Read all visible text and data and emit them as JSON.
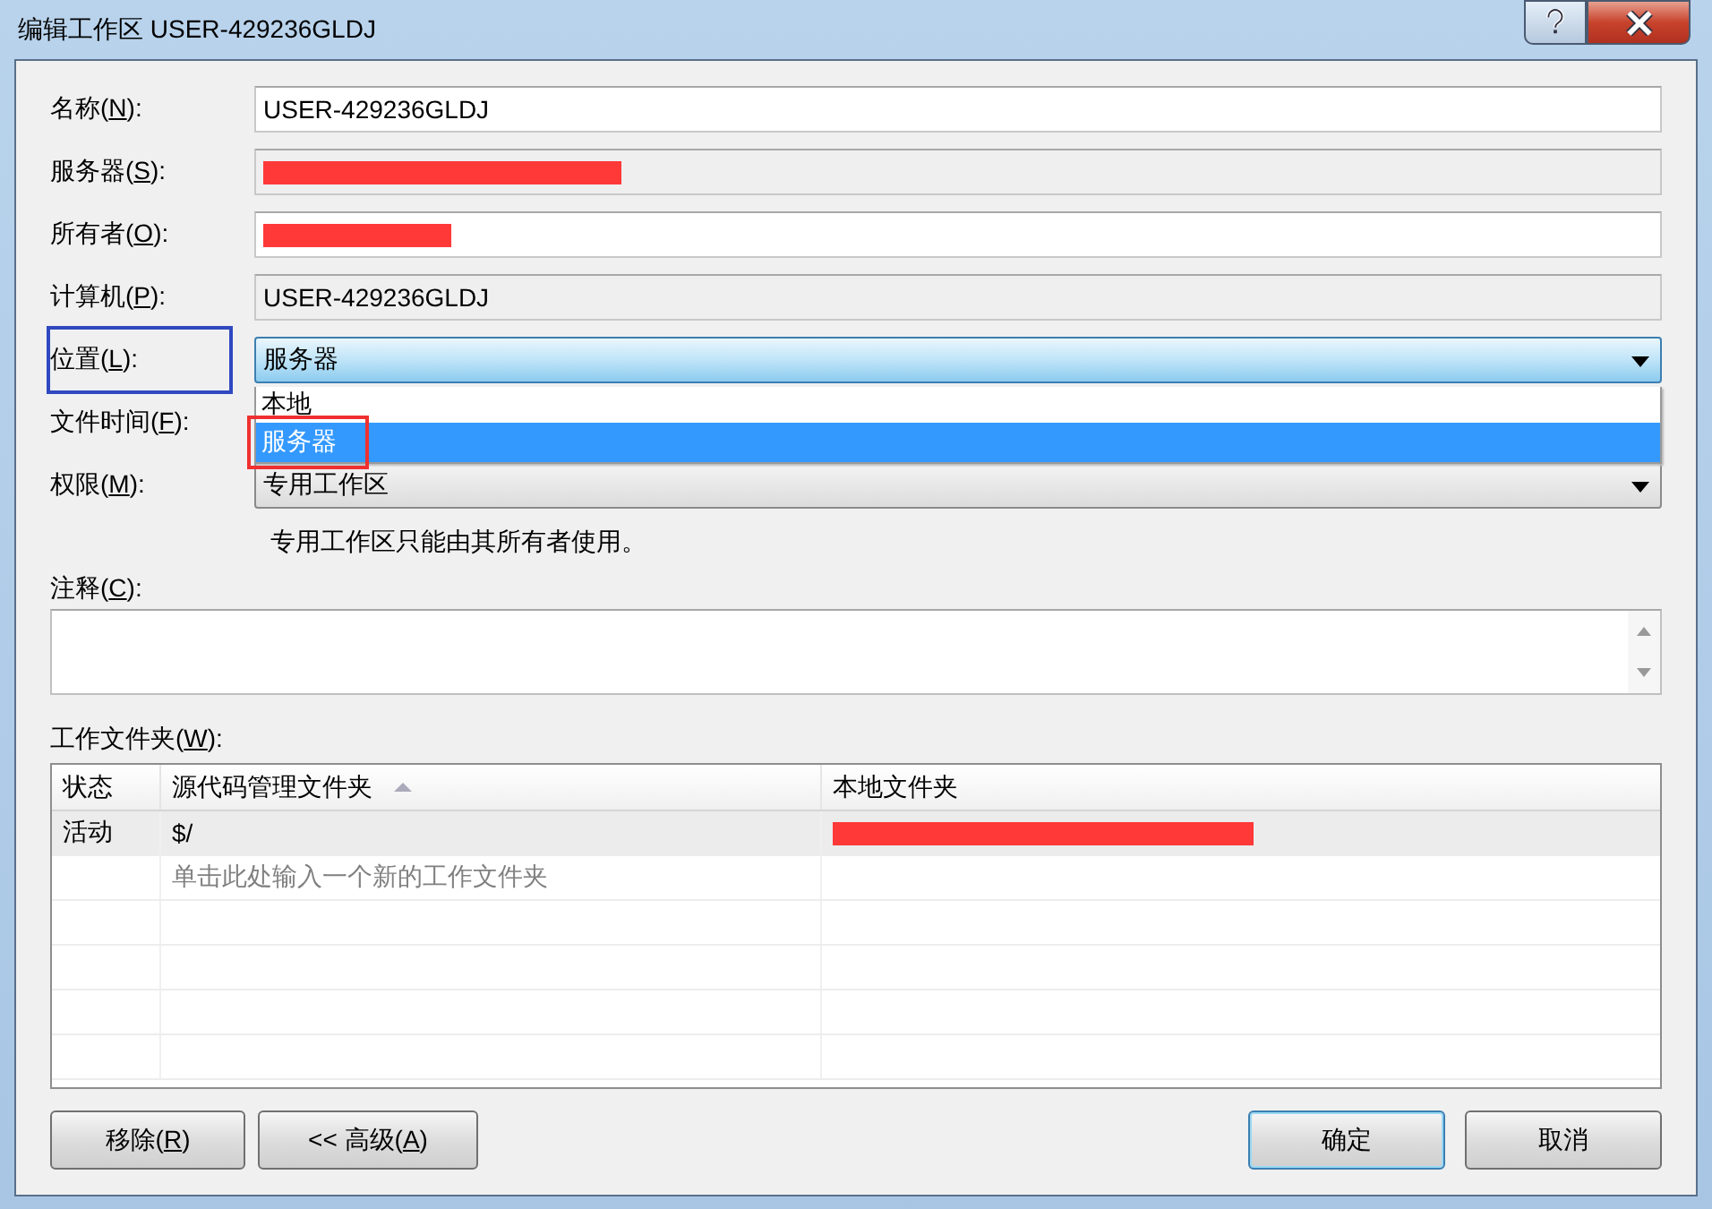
{
  "window": {
    "title": "编辑工作区 USER-429236GLDJ",
    "buttons": [
      {
        "kind": "help"
      },
      {
        "kind": "close"
      }
    ]
  },
  "fields": [
    {
      "label": [
        "名称(",
        "N",
        "):"
      ],
      "kind": "text",
      "value": "USER-429236GLDJ",
      "redacted": false
    },
    {
      "label": [
        "服务器(",
        "S",
        "):"
      ],
      "kind": "readonly",
      "redacted": true
    },
    {
      "label": [
        "所有者(",
        "O",
        "):"
      ],
      "kind": "text",
      "redacted": true
    },
    {
      "label": [
        "计算机(",
        "P",
        "):"
      ],
      "kind": "readonly",
      "value": "USER-429236GLDJ",
      "redacted": false
    },
    {
      "label": [
        "位置(",
        "L",
        "):"
      ],
      "kind": "combo",
      "value": "服务器",
      "redacted": false,
      "focused": true,
      "color": "#3048c0",
      "dropdown": [
        {
          "label": "本地",
          "selected": false
        },
        {
          "label": "服务器",
          "selected": true,
          "color": "#f03030"
        }
      ]
    },
    {
      "label": [
        "文件时间(",
        "F",
        "):"
      ],
      "kind": "hidden"
    },
    {
      "label": [
        "权限(",
        "M",
        "):"
      ],
      "kind": "combo",
      "value": "专用工作区",
      "redacted": false,
      "focused": false
    }
  ],
  "permission_note": "专用工作区只能由其所有者使用。",
  "comment": {
    "label": [
      "注释(",
      "C",
      "):"
    ]
  },
  "folders": {
    "label": [
      "工作文件夹(",
      "W",
      "):"
    ],
    "columns": [
      {
        "label": "状态",
        "sorted": false
      },
      {
        "label": "源代码管理文件夹",
        "sorted": true
      },
      {
        "label": "本地文件夹",
        "sorted": false
      }
    ],
    "rows": [
      {
        "cells": [
          "活动",
          "$/"
        ],
        "local_redacted": true,
        "selected": true
      }
    ],
    "new_row_placeholder": "单击此处输入一个新的工作文件夹"
  },
  "buttons": [
    {
      "label": [
        "移除(",
        "R",
        ")"
      ],
      "default": false
    },
    {
      "label": [
        "<< 高级(",
        "A",
        ")"
      ],
      "default": false
    },
    {
      "label": [
        "确定"
      ],
      "default": true
    },
    {
      "label": [
        "取消"
      ],
      "default": false
    }
  ]
}
